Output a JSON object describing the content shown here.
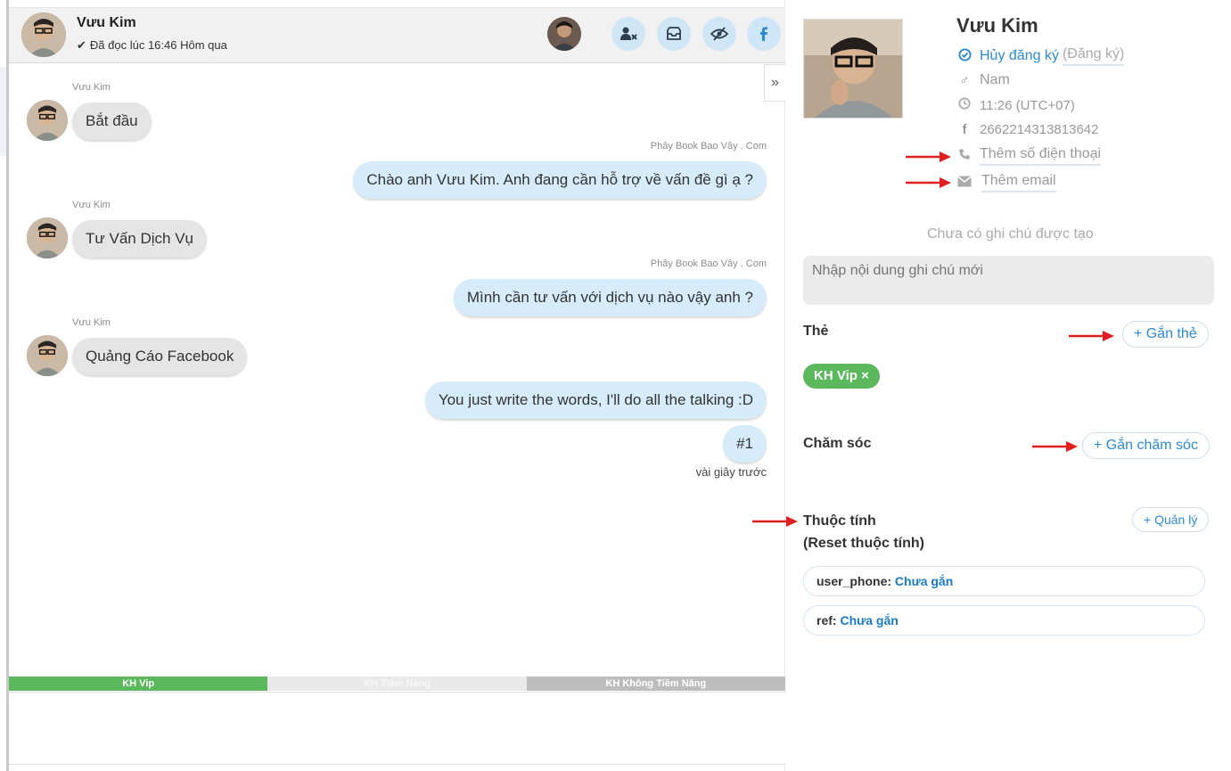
{
  "header": {
    "name": "Vưu Kim",
    "status": "Đã đọc lúc 16:46 Hôm qua",
    "buttons": [
      "user-remove-icon",
      "inbox-icon",
      "eye-slash-icon",
      "facebook-icon"
    ],
    "colors": {
      "button_bg": "#cfe6f7",
      "button_icon": "#2d3e50",
      "facebook": "#2b8ad1"
    }
  },
  "conversation": {
    "messages": [
      {
        "direction": "in",
        "sender": "Vưu Kim",
        "text": "Bắt đầu"
      },
      {
        "direction": "out",
        "sender": "Phây Book Bao Vây . Com",
        "text": "Chào anh Vưu Kim. Anh đang cần hỗ trợ về vấn đề gì ạ ?"
      },
      {
        "direction": "in",
        "sender": "Vưu Kim",
        "text": "Tư Vấn Dịch Vụ"
      },
      {
        "direction": "out",
        "sender": "Phây Book Bao Vây . Com",
        "text": "Mình cần tư vấn với dịch vụ nào vậy anh ?"
      },
      {
        "direction": "in",
        "sender": "Vưu Kim",
        "text": "Quảng Cáo Facebook"
      },
      {
        "direction": "out",
        "sender": "",
        "text": "You just write the words, I'll do all the talking :D"
      },
      {
        "direction": "out",
        "sender": "",
        "text": "#1"
      }
    ],
    "last_time": "vài giây trước",
    "collapse_glyph": "»"
  },
  "tag_bar": {
    "tags": [
      "KH Vip",
      "KH Tiềm Năng",
      "KH Không Tiềm Năng"
    ],
    "colors": [
      "#5cb85c",
      "#e9e9e9",
      "#bdbdbd"
    ]
  },
  "profile": {
    "name": "Vưu Kim",
    "unsubscribe": "Hủy đăng ký",
    "subscribe": "(Đăng ký)",
    "gender": "Nam",
    "time": "11:26 (UTC+07)",
    "fb_id": "2662214313813642",
    "add_phone": "Thêm số điện thoại",
    "add_email": "Thêm email"
  },
  "notes": {
    "empty": "Chưa có ghi chú được tạo",
    "placeholder": "Nhập nội dung ghi chú mới"
  },
  "tags_section": {
    "label": "Thẻ",
    "add_button": "+ Gắn thẻ",
    "chips": [
      "KH Vip ×"
    ]
  },
  "care_section": {
    "label": "Chăm sóc",
    "add_button": "+ Gắn chăm sóc"
  },
  "attributes": {
    "label": "Thuộc tính",
    "reset": "(Reset thuộc tính)",
    "manage_button": "+ Quản lý",
    "items": [
      {
        "key": "user_phone:",
        "value": "Chưa gắn"
      },
      {
        "key": "ref:",
        "value": "Chưa gắn"
      }
    ]
  },
  "accent": {
    "blue": "#2b8ad1",
    "arrow": "#e02020"
  }
}
